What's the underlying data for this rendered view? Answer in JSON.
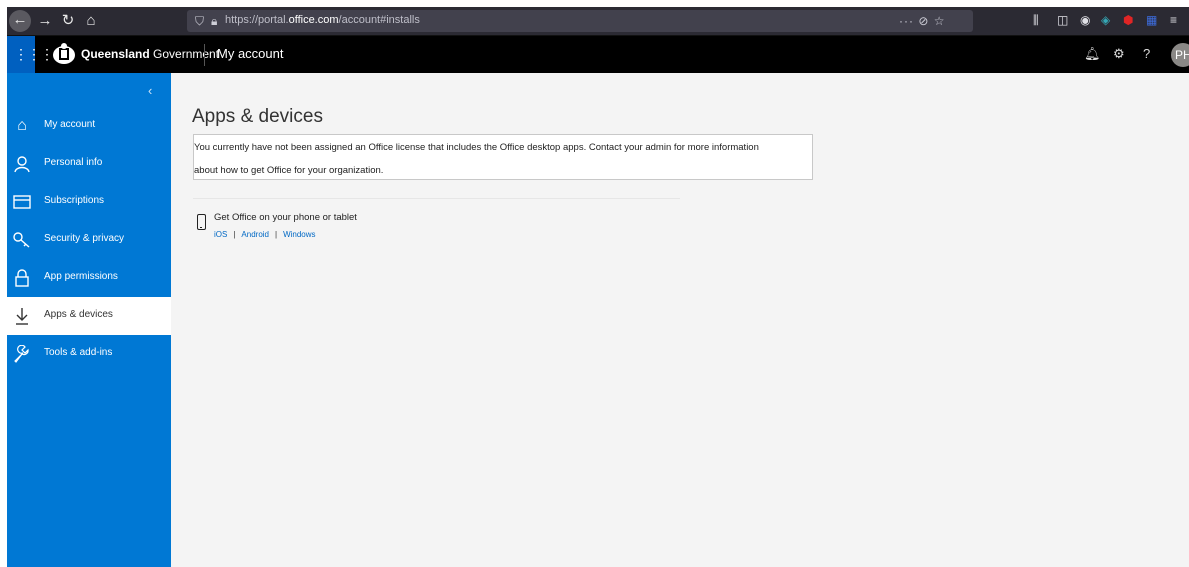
{
  "browser": {
    "url_prefix": "https://portal.",
    "url_domain": "office.com",
    "url_path": "/account#installs",
    "page_actions": "··· ⊘ ☆"
  },
  "header": {
    "brand_bold": "Queensland",
    "brand_rest": " Government",
    "app_title": "My account",
    "avatar_initials": "PH"
  },
  "sidebar": {
    "items": [
      {
        "label": "My account",
        "icon": "home-icon"
      },
      {
        "label": "Personal info",
        "icon": "person-icon"
      },
      {
        "label": "Subscriptions",
        "icon": "card-icon"
      },
      {
        "label": "Security & privacy",
        "icon": "key-icon"
      },
      {
        "label": "App permissions",
        "icon": "lock-icon"
      },
      {
        "label": "Apps & devices",
        "icon": "download-icon",
        "active": true
      },
      {
        "label": "Tools & add-ins",
        "icon": "wrench-icon"
      }
    ]
  },
  "main": {
    "title": "Apps & devices",
    "notice_line1": "You currently have not been assigned an Office license that includes the Office desktop apps. Contact your admin for more information",
    "notice_line2": "about how to get Office for your organization.",
    "mobile_heading": "Get Office on your phone or tablet",
    "links": {
      "ios": "iOS",
      "android": "Android",
      "windows": "Windows",
      "separator": "|"
    }
  },
  "colors": {
    "accent": "#0078d4",
    "waffle": "#0060c0",
    "link": "#0068c4",
    "browser_chrome": "#2b2a33"
  }
}
